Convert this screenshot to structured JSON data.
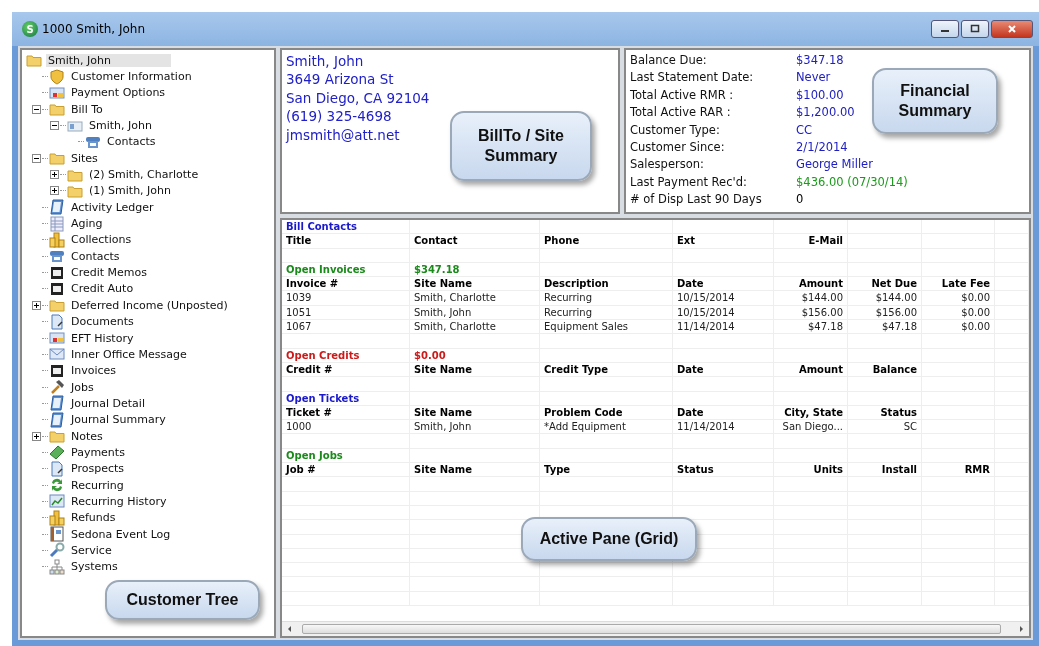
{
  "window": {
    "logo_letter": "S",
    "title": "1000  Smith, John"
  },
  "tree": {
    "callout": "Customer Tree",
    "items": [
      {
        "label": "Smith, John",
        "kind": "folder",
        "selected": true,
        "children": [
          {
            "label": "Customer Information",
            "kind": "shield",
            "selected": false
          },
          {
            "label": "Payment Options",
            "kind": "card",
            "selected": false
          },
          {
            "label": "Bill To",
            "kind": "folder",
            "selected": false,
            "expanded": true,
            "children": [
              {
                "label": "Smith, John",
                "kind": "contact-card",
                "selected": false,
                "expanded": true,
                "children": [
                  {
                    "label": "Contacts",
                    "kind": "phone",
                    "selected": false
                  }
                ]
              }
            ]
          },
          {
            "label": "Sites",
            "kind": "folder",
            "selected": false,
            "expanded": true,
            "children": [
              {
                "label": "(2) Smith, Charlotte",
                "kind": "folder",
                "selected": false,
                "expanded": false
              },
              {
                "label": "(1) Smith, John",
                "kind": "folder",
                "selected": false,
                "expanded": false
              }
            ]
          },
          {
            "label": "Activity Ledger",
            "kind": "ledger",
            "selected": false
          },
          {
            "label": "Aging",
            "kind": "grid",
            "selected": false
          },
          {
            "label": "Collections",
            "kind": "coins",
            "selected": false
          },
          {
            "label": "Contacts",
            "kind": "phone",
            "selected": false
          },
          {
            "label": "Credit Memos",
            "kind": "film",
            "selected": false
          },
          {
            "label": "Credit Auto",
            "kind": "film",
            "selected": false
          },
          {
            "label": "Deferred Income (Unposted)",
            "kind": "folder",
            "selected": false,
            "expanded": false
          },
          {
            "label": "Documents",
            "kind": "document",
            "selected": false
          },
          {
            "label": "EFT History",
            "kind": "card",
            "selected": false
          },
          {
            "label": "Inner Office Message",
            "kind": "mail",
            "selected": false
          },
          {
            "label": "Invoices",
            "kind": "film",
            "selected": false
          },
          {
            "label": "Jobs",
            "kind": "hammer",
            "selected": false
          },
          {
            "label": "Journal Detail",
            "kind": "ledger",
            "selected": false
          },
          {
            "label": "Journal Summary",
            "kind": "ledger",
            "selected": false
          },
          {
            "label": "Notes",
            "kind": "folder",
            "selected": false,
            "expanded": false
          },
          {
            "label": "Payments",
            "kind": "money",
            "selected": false
          },
          {
            "label": "Prospects",
            "kind": "document",
            "selected": false
          },
          {
            "label": "Recurring",
            "kind": "recycle",
            "selected": false
          },
          {
            "label": "Recurring History",
            "kind": "chart",
            "selected": false
          },
          {
            "label": "Refunds",
            "kind": "coins",
            "selected": false
          },
          {
            "label": "Sedona Event Log",
            "kind": "log",
            "selected": false
          },
          {
            "label": "Service",
            "kind": "wrench",
            "selected": false
          },
          {
            "label": "Systems",
            "kind": "network",
            "selected": false
          }
        ]
      }
    ]
  },
  "summary": {
    "callout": "BillTo / Site Summary",
    "lines": [
      "Smith, John",
      "3649 Arizona St",
      "San Diego, CA  92104",
      "(619) 325-4698",
      "jmsmith@att.net"
    ]
  },
  "financial": {
    "callout": "Financial Summary",
    "rows": [
      {
        "label": "Balance Due:",
        "value": "$347.18",
        "color": "#2020c0"
      },
      {
        "label": "Last Statement Date:",
        "value": "Never",
        "color": "#2020c0"
      },
      {
        "label": "Total Active RMR :",
        "value": "$100.00",
        "color": "#2020c0"
      },
      {
        "label": "Total Active RAR :",
        "value": "$1,200.00",
        "color": "#2020c0"
      },
      {
        "label": "Customer Type:",
        "value": "CC",
        "color": "#2020c0"
      },
      {
        "label": "Customer Since:",
        "value": "2/1/2014",
        "color": "#2020c0"
      },
      {
        "label": "Salesperson:",
        "value": "George Miller",
        "color": "#2020c0"
      },
      {
        "label": "Last Payment Rec'd:",
        "value": "$436.00 (07/30/14)",
        "color": "#1a9a1a"
      },
      {
        "label": "# of Disp Last 90 Days",
        "value": "0",
        "color": "#000000"
      }
    ]
  },
  "grid": {
    "callout": "Active Pane (Grid)",
    "rows": [
      {
        "kind": "section",
        "color": "#1a1acc",
        "cells": [
          "Bill Contacts"
        ]
      },
      {
        "kind": "header",
        "cells": [
          "Title",
          "Contact",
          "Phone",
          "Ext",
          "E-Mail"
        ]
      },
      {
        "kind": "blank"
      },
      {
        "kind": "section",
        "color": "#1a8a1a",
        "cells": [
          "Open Invoices",
          "$347.18"
        ]
      },
      {
        "kind": "header",
        "cells": [
          "Invoice #",
          "Site Name",
          "Description",
          "Date",
          "Amount",
          "Net Due",
          "Late Fee"
        ]
      },
      {
        "kind": "data",
        "cells": [
          "1039",
          "Smith, Charlotte",
          "Recurring",
          "10/15/2014",
          "$144.00",
          "$144.00",
          "$0.00"
        ]
      },
      {
        "kind": "data",
        "cells": [
          "1051",
          "Smith, John",
          "Recurring",
          "10/15/2014",
          "$156.00",
          "$156.00",
          "$0.00"
        ]
      },
      {
        "kind": "data",
        "cells": [
          "1067",
          "Smith, Charlotte",
          "Equipment Sales",
          "11/14/2014",
          "$47.18",
          "$47.18",
          "$0.00"
        ]
      },
      {
        "kind": "blank"
      },
      {
        "kind": "section",
        "color": "#cc1a1a",
        "cells": [
          "Open Credits",
          "$0.00"
        ]
      },
      {
        "kind": "header",
        "cells": [
          "Credit #",
          "Site Name",
          "Credit Type",
          "Date",
          "Amount",
          "Balance"
        ]
      },
      {
        "kind": "blank"
      },
      {
        "kind": "section",
        "color": "#1a1acc",
        "cells": [
          "Open Tickets"
        ]
      },
      {
        "kind": "header",
        "cells": [
          "Ticket #",
          "Site Name",
          "Problem Code",
          "Date",
          "City, State",
          "Status"
        ]
      },
      {
        "kind": "data",
        "cells": [
          "1000",
          "Smith, John",
          "*Add Equipment",
          "11/14/2014",
          "San Diego...",
          "SC"
        ]
      },
      {
        "kind": "blank"
      },
      {
        "kind": "section",
        "color": "#1a8a1a",
        "cells": [
          "Open Jobs"
        ]
      },
      {
        "kind": "header",
        "cells": [
          "Job #",
          "Site Name",
          "Type",
          "Status",
          "Units",
          "Install",
          "RMR"
        ]
      }
    ]
  }
}
